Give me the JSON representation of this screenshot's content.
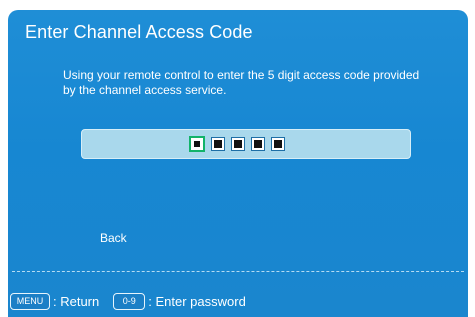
{
  "dialog": {
    "title": "Enter Channel Access Code",
    "instructions": "Using your remote control to enter the 5 digit access code provided by the channel access service.",
    "code_digits": 5,
    "active_digit_index": 1,
    "back_label": "Back"
  },
  "footer": {
    "menu_key_label": "MENU",
    "menu_hint": ": Return",
    "digits_key_label": "0-9",
    "digits_hint": ": Enter password"
  },
  "colors": {
    "background": "#1787d2",
    "code_bar": "#a9d8ec",
    "active_digit_border": "#12b36a",
    "text": "#ffffff"
  }
}
